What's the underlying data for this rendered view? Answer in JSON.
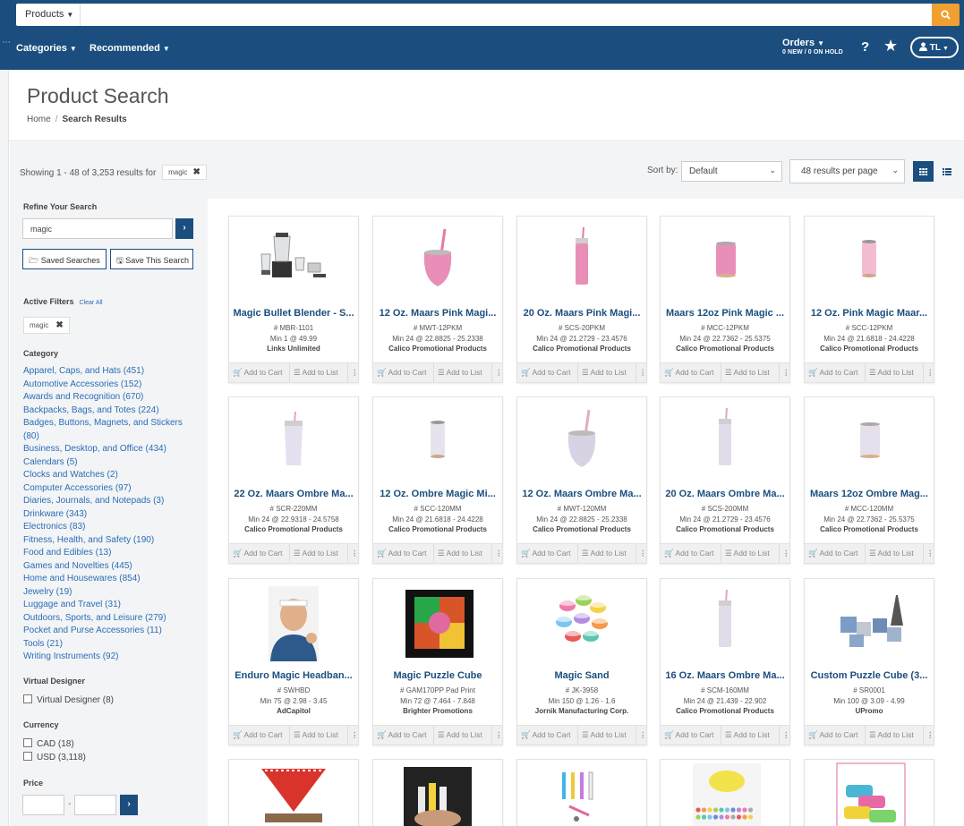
{
  "header": {
    "scope_label": "Products",
    "search_value": "",
    "nav": [
      "Categories",
      "Recommended"
    ],
    "orders_label": "Orders",
    "orders_sub": "0 NEW / 0 ON HOLD",
    "help_label": "?",
    "user_initials": "TL"
  },
  "page": {
    "title": "Product Search",
    "breadcrumb_home": "Home",
    "breadcrumb_current": "Search Results"
  },
  "results": {
    "showing_text": "Showing 1 - 48 of 3,253 results for",
    "query_chip": "magic",
    "sort_label": "Sort by:",
    "sort_value": "Default",
    "per_page_value": "48 results per page"
  },
  "sidebar": {
    "refine_heading": "Refine Your Search",
    "refine_value": "magic",
    "saved_searches_label": "Saved Searches",
    "save_this_search_label": "Save This Search",
    "active_filters_heading": "Active Filters",
    "clear_all_label": "Clear All",
    "active_filter_chip": "magic",
    "category_heading": "Category",
    "categories": [
      "Apparel, Caps, and Hats (451)",
      "Automotive Accessories (152)",
      "Awards and Recognition (670)",
      "Backpacks, Bags, and Totes (224)",
      "Badges, Buttons, Magnets, and Stickers (80)",
      "Business, Desktop, and Office (434)",
      "Calendars (5)",
      "Clocks and Watches (2)",
      "Computer Accessories (97)",
      "Diaries, Journals, and Notepads (3)",
      "Drinkware (343)",
      "Electronics (83)",
      "Fitness, Health, and Safety (190)",
      "Food and Edibles (13)",
      "Games and Novelties (445)",
      "Home and Housewares (854)",
      "Jewelry (19)",
      "Luggage and Travel (31)",
      "Outdoors, Sports, and Leisure (279)",
      "Pocket and Purse Accessories (11)",
      "Tools (21)",
      "Writing Instruments (92)"
    ],
    "virtual_designer_heading": "Virtual Designer",
    "virtual_designer_option": "Virtual Designer (8)",
    "currency_heading": "Currency",
    "currency_options": [
      "CAD (18)",
      "USD (3,118)"
    ],
    "price_heading": "Price",
    "price_separator": "-"
  },
  "card_actions": {
    "add_to_cart": "Add to Cart",
    "add_to_list": "Add to List",
    "more": "⋮"
  },
  "products": [
    {
      "name": "Magic Bullet Blender - S...",
      "sku": "# MBR-1101",
      "min": "Min 1 @ 49.99",
      "supplier": "Links Unlimited",
      "art": "blender"
    },
    {
      "name": "12 Oz. Maars Pink Magi...",
      "sku": "# MWT-12PKM",
      "min": "Min 24 @ 22.8825 - 25.2338",
      "supplier": "Calico Promotional Products",
      "art": "wine-pink"
    },
    {
      "name": "20 Oz. Maars Pink Magi...",
      "sku": "# SCS-20PKM",
      "min": "Min 24 @ 21.2729 - 23.4576",
      "supplier": "Calico Promotional Products",
      "art": "tall-pink"
    },
    {
      "name": "Maars 12oz Pink Magic ...",
      "sku": "# MCC-12PKM",
      "min": "Min 24 @ 22.7362 - 25.5375",
      "supplier": "Calico Promotional Products",
      "art": "can-pink"
    },
    {
      "name": "12 Oz. Pink Magic Maar...",
      "sku": "# SCC-12PKM",
      "min": "Min 24 @ 21.6818 - 24.4228",
      "supplier": "Calico Promotional Products",
      "art": "slim-pink"
    },
    {
      "name": "22 Oz. Maars Ombre Ma...",
      "sku": "# SCR-220MM",
      "min": "Min 24 @ 22.9318 - 24.5758",
      "supplier": "Calico Promotional Products",
      "art": "tumbler-ombre"
    },
    {
      "name": "12 Oz. Ombre Magic Mi...",
      "sku": "# SCC-120MM",
      "min": "Min 24 @ 21.6818 - 24.4228",
      "supplier": "Calico Promotional Products",
      "art": "slim-ombre"
    },
    {
      "name": "12 Oz. Maars Ombre Ma...",
      "sku": "# MWT-120MM",
      "min": "Min 24 @ 22.8825 - 25.2338",
      "supplier": "Calico Promotional Products",
      "art": "wine-ombre"
    },
    {
      "name": "20 Oz. Maars Ombre Ma...",
      "sku": "# SCS-200MM",
      "min": "Min 24 @ 21.2729 - 23.4576",
      "supplier": "Calico Promotional Products",
      "art": "tall-ombre"
    },
    {
      "name": "Maars 12oz Ombre Mag...",
      "sku": "# MCC-120MM",
      "min": "Min 24 @ 22.7362 - 25.5375",
      "supplier": "Calico Promotional Products",
      "art": "can-ombre"
    },
    {
      "name": "Enduro Magic Headban...",
      "sku": "# SWHBD",
      "min": "Min 75 @ 2.98 - 3.45",
      "supplier": "AdCapitol",
      "art": "person"
    },
    {
      "name": "Magic Puzzle Cube",
      "sku": "# GAM170PP Pad Print",
      "min": "Min 72 @ 7.464 - 7.848",
      "supplier": "Brighter Promotions",
      "art": "cube"
    },
    {
      "name": "Magic Sand",
      "sku": "# JK-3958",
      "min": "Min 150 @ 1.26 - 1.6",
      "supplier": "Jornik Manufacturing Corp.",
      "art": "sand"
    },
    {
      "name": "16 Oz. Maars Ombre Ma...",
      "sku": "# SCM-160MM",
      "min": "Min 24 @ 21.439 - 22.902",
      "supplier": "Calico Promotional Products",
      "art": "tall-ombre2"
    },
    {
      "name": "Custom Puzzle Cube (3...",
      "sku": "# SR0001",
      "min": "Min 100 @ 3.09 - 4.99",
      "supplier": "UPromo",
      "art": "puzzle-cubes"
    },
    {
      "name": "",
      "sku": "",
      "min": "",
      "supplier": "",
      "art": "bandana"
    },
    {
      "name": "",
      "sku": "",
      "min": "",
      "supplier": "",
      "art": "sticks"
    },
    {
      "name": "",
      "sku": "",
      "min": "",
      "supplier": "",
      "art": "pens"
    },
    {
      "name": "",
      "sku": "",
      "min": "",
      "supplier": "",
      "art": "putty"
    },
    {
      "name": "",
      "sku": "",
      "min": "",
      "supplier": "",
      "art": "towels"
    }
  ]
}
